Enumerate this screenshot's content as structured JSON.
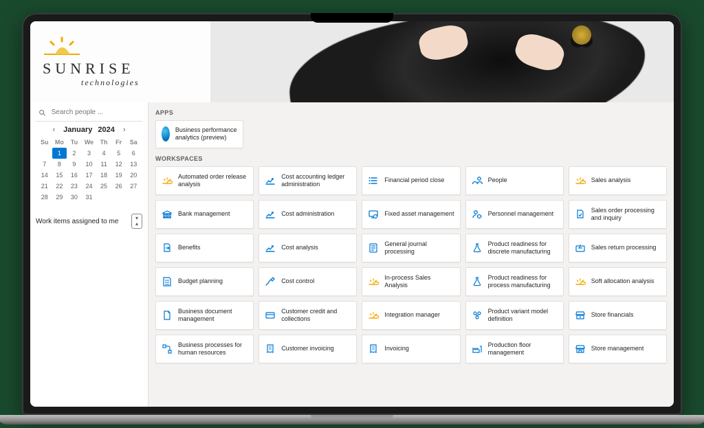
{
  "logo": {
    "word": "SUNRISE",
    "sub": "technologies"
  },
  "search": {
    "placeholder": "Search people ..."
  },
  "calendar": {
    "month": "January",
    "year": "2024",
    "day_headers": [
      "Su",
      "Mo",
      "Tu",
      "We",
      "Th",
      "Fr",
      "Sa"
    ],
    "weeks": [
      [
        "",
        "1",
        "2",
        "3",
        "4",
        "5",
        "6"
      ],
      [
        "7",
        "8",
        "9",
        "10",
        "11",
        "12",
        "13"
      ],
      [
        "14",
        "15",
        "16",
        "17",
        "18",
        "19",
        "20"
      ],
      [
        "21",
        "22",
        "23",
        "24",
        "25",
        "26",
        "27"
      ],
      [
        "28",
        "29",
        "30",
        "31",
        "",
        "",
        ""
      ]
    ],
    "today": "1"
  },
  "work_items": {
    "label": "Work items assigned to me"
  },
  "sections": {
    "apps": "APPS",
    "workspaces": "WORKSPACES"
  },
  "apps": [
    {
      "label": "Business performance analytics (preview)"
    }
  ],
  "workspaces": [
    {
      "label": "Automated order release analysis",
      "icon": "sunrise"
    },
    {
      "label": "Cost accounting ledger administration",
      "icon": "chart-up"
    },
    {
      "label": "Financial period close",
      "icon": "list"
    },
    {
      "label": "People",
      "icon": "people"
    },
    {
      "label": "Sales analysis",
      "icon": "sunrise"
    },
    {
      "label": "Bank management",
      "icon": "bank"
    },
    {
      "label": "Cost administration",
      "icon": "chart-up"
    },
    {
      "label": "Fixed asset management",
      "icon": "asset"
    },
    {
      "label": "Personnel management",
      "icon": "person-cog"
    },
    {
      "label": "Sales order processing and inquiry",
      "icon": "doc-check"
    },
    {
      "label": "Benefits",
      "icon": "doc-arrow"
    },
    {
      "label": "Cost analysis",
      "icon": "chart-up"
    },
    {
      "label": "General journal processing",
      "icon": "journal"
    },
    {
      "label": "Product readiness for discrete manufacturing",
      "icon": "flask"
    },
    {
      "label": "Sales return processing",
      "icon": "box-return"
    },
    {
      "label": "Budget planning",
      "icon": "budget"
    },
    {
      "label": "Cost control",
      "icon": "hammer-chart"
    },
    {
      "label": "In-process Sales Analysis",
      "icon": "sunrise"
    },
    {
      "label": "Product readiness for process manufacturing",
      "icon": "flask"
    },
    {
      "label": "Soft allocation analysis",
      "icon": "sunrise"
    },
    {
      "label": "Business document management",
      "icon": "doc"
    },
    {
      "label": "Customer credit and collections",
      "icon": "credit"
    },
    {
      "label": "Integration manager",
      "icon": "sunrise"
    },
    {
      "label": "Product variant model definition",
      "icon": "variant"
    },
    {
      "label": "Store financials",
      "icon": "store-fin"
    },
    {
      "label": "Business processes for human resources",
      "icon": "process"
    },
    {
      "label": "Customer invoicing",
      "icon": "invoice"
    },
    {
      "label": "Invoicing",
      "icon": "invoice"
    },
    {
      "label": "Production floor management",
      "icon": "factory"
    },
    {
      "label": "Store management",
      "icon": "store"
    }
  ]
}
